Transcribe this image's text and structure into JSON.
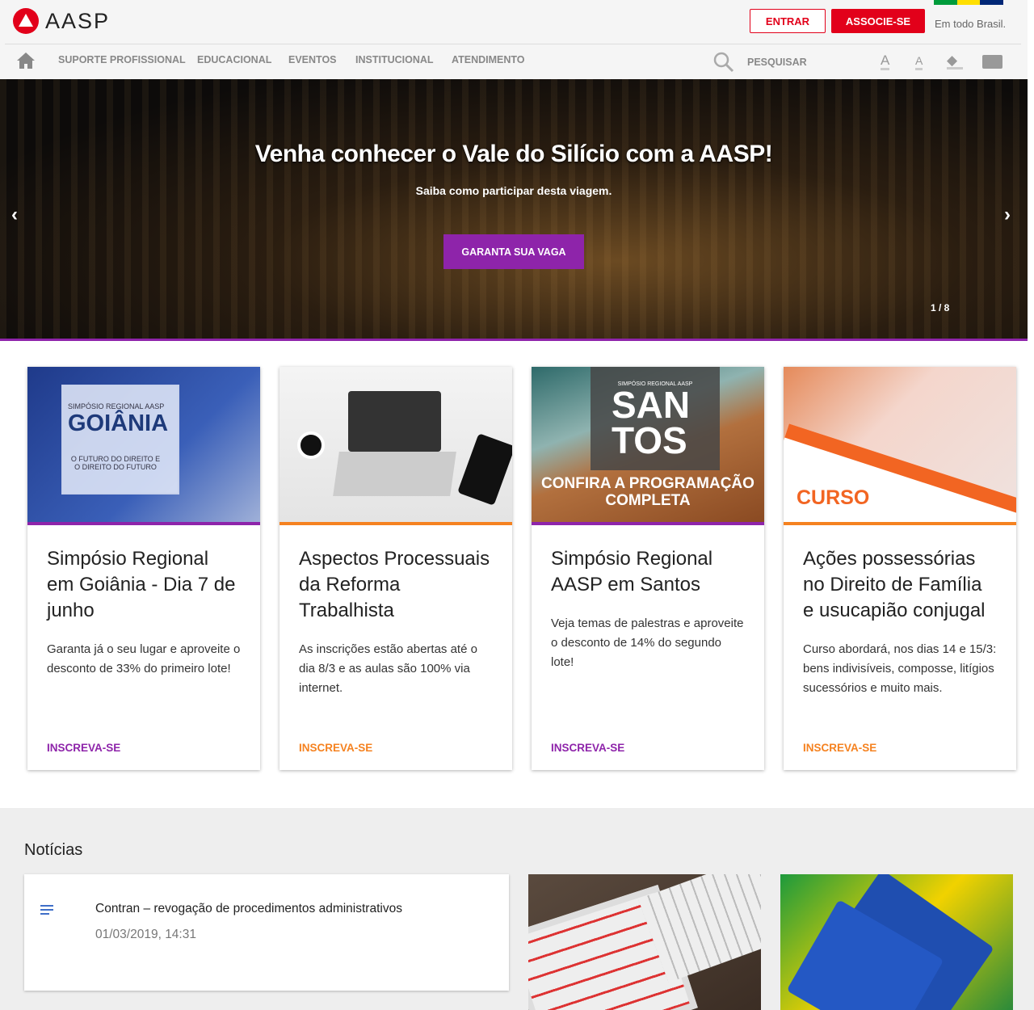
{
  "header": {
    "logo": "AASP",
    "enter": "ENTRAR",
    "join": "ASSOCIE-SE",
    "tagline": "Em todo Brasil.",
    "flag_colors": [
      "#009c3b",
      "#ffdf00",
      "#002776"
    ]
  },
  "nav": {
    "items": [
      "SUPORTE PROFISSIONAL",
      "EDUCACIONAL",
      "EVENTOS",
      "INSTITUCIONAL",
      "ATENDIMENTO"
    ],
    "search": "PESQUISAR",
    "font_increase": "A",
    "font_decrease": "A"
  },
  "hero": {
    "title": "Venha conhecer o Vale do Silício com a AASP!",
    "subtitle": "Saiba como participar desta viagem.",
    "cta": "GARANTA SUA VAGA",
    "counter": "1 / 8"
  },
  "colors": {
    "purple": "#8e24aa",
    "orange": "#f58220",
    "red": "#e2001a"
  },
  "cards": [
    {
      "img_lines": [
        "SIMPÓSIO REGIONAL AASP",
        "GOIÂNIA",
        "O FUTURO DO DIREITO E O DIREITO DO FUTURO"
      ],
      "title": "Simpósio Regional em Goiânia - Dia 7 de junho",
      "desc": "Garanta já o seu lugar e aproveite o desconto de 33% do primeiro lote!",
      "link": "INSCREVA-SE"
    },
    {
      "title": "Aspectos Processuais da Reforma Trabalhista",
      "desc": "As inscrições estão abertas até o dia 8/3 e as aulas são 100% via internet.",
      "link": "INSCREVA-SE"
    },
    {
      "img_lines": [
        "SIMPÓSIO REGIONAL AASP",
        "SAN",
        "TOS",
        "CONFIRA A PROGRAMAÇÃO COMPLETA"
      ],
      "title": "Simpósio Regional AASP em Santos",
      "desc": "Veja temas de palestras e aproveite o desconto de 14% do segundo lote!",
      "link": "INSCREVA-SE"
    },
    {
      "img_lines": [
        "CURSO"
      ],
      "title": "Ações possessórias no Direito de Família e usucapião conjugal",
      "desc": "Curso abordará, nos dias 14 e 15/3: bens indivisíveis, composse, litígios sucessórios e muito mais.",
      "link": "INSCREVA-SE"
    }
  ],
  "news": {
    "heading": "Notícias",
    "items": [
      {
        "title": "Contran – revogação de procedimentos administrativos",
        "date": "01/03/2019, 14:31"
      }
    ]
  }
}
